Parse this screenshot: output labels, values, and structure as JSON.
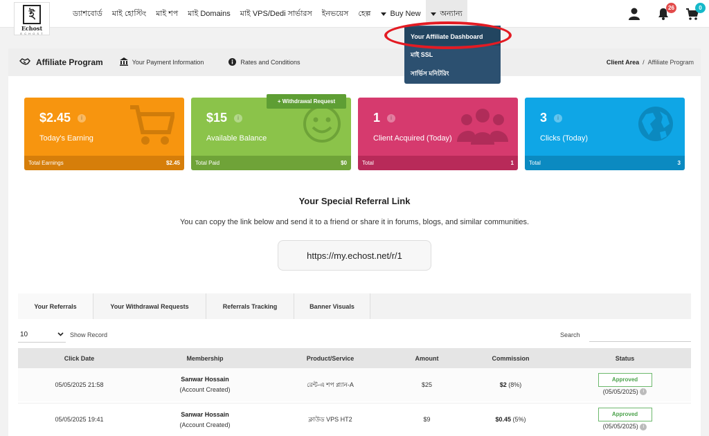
{
  "logo": {
    "mark": "ই",
    "name": "Echost",
    "sub": "E C H O S T"
  },
  "nav": {
    "items": [
      "ড্যাশবোর্ড",
      "মাই হোস্টিং",
      "মাই শপ",
      "মাই Domains",
      "মাই VPS/Dedi সার্ভারস",
      "ইনভয়েস",
      "হেল্প"
    ],
    "buy_new": "Buy New",
    "more": "অন্যান্য",
    "notif_count": "26",
    "cart_count": "0"
  },
  "dropdown": {
    "items": [
      "Your Affiliate Dashboard",
      "মাই SSL",
      "সার্ভিস মনিটরিং"
    ]
  },
  "subheader": {
    "title": "Affiliate Program",
    "payment_link": "Your Payment Information",
    "rates_link": "Rates and Conditions",
    "crumb_root": "Client Area",
    "crumb_sep": "/",
    "crumb_current": "Affiliate Program"
  },
  "withdrawal_button": "+ Withdrawal Request",
  "cards": [
    {
      "value": "$2.45",
      "label": "Today's Earning",
      "foot_label": "Total Earnings",
      "foot_value": "$2.45",
      "color": "#f7950f",
      "foot_color": "#d67e0a"
    },
    {
      "value": "$15",
      "label": "Available Balance",
      "foot_label": "Total Paid",
      "foot_value": "$0",
      "color": "#8bc34a",
      "foot_color": "#6fa338"
    },
    {
      "value": "1",
      "label": "Client Acquired (Today)",
      "foot_label": "Total",
      "foot_value": "1",
      "color": "#d63a6e",
      "foot_color": "#b82a59"
    },
    {
      "value": "3",
      "label": "Clicks (Today)",
      "foot_label": "Total",
      "foot_value": "3",
      "color": "#0fa6e6",
      "foot_color": "#0b8ac1"
    }
  ],
  "referral": {
    "title": "Your Special Referral Link",
    "description": "You can copy the link below and send it to a friend or share it in forums, blogs, and similar communities.",
    "link": "https://my.echost.net/r/1"
  },
  "tabs": [
    "Your Referrals",
    "Your Withdrawal Requests",
    "Referrals Tracking",
    "Banner Visuals"
  ],
  "table_controls": {
    "records": "10",
    "records_label": "Show Record",
    "search_label": "Search"
  },
  "table": {
    "headers": [
      "Click Date",
      "Membership",
      "Product/Service",
      "Amount",
      "Commission",
      "Status"
    ],
    "rows": [
      {
        "date": "05/05/2025 21:58",
        "name": "Sanwar Hossain",
        "note": "(Account Created)",
        "product": "রেন্ট-এ শপ প্ল্যান-A",
        "amount": "$25",
        "commission": "$2",
        "commission_pct": "(8%)",
        "status": "Approved",
        "status_date": "(05/05/2025)"
      },
      {
        "date": "05/05/2025 19:41",
        "name": "Sanwar Hossain",
        "note": "(Account Created)",
        "product": "ক্লাউড VPS HT2",
        "amount": "$9",
        "commission": "$0.45",
        "commission_pct": "(5%)",
        "status": "Approved",
        "status_date": "(05/05/2025)"
      }
    ]
  }
}
